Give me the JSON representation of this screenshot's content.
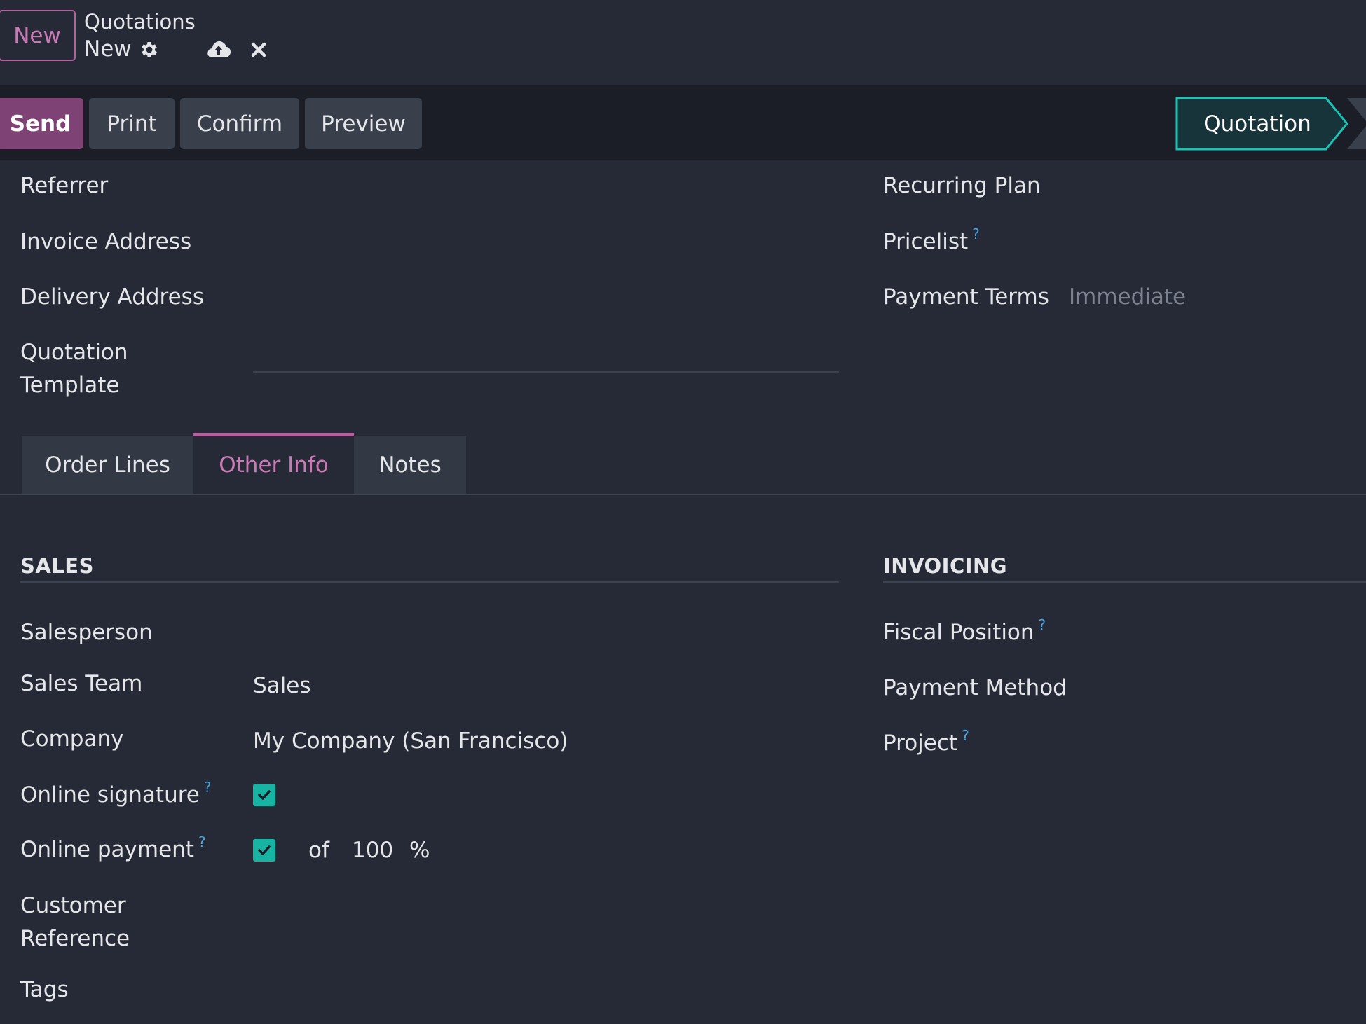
{
  "topbar": {
    "new_label": "New",
    "breadcrumb_parent": "Quotations",
    "breadcrumb_current": "New"
  },
  "actions": {
    "send": "Send",
    "print": "Print",
    "confirm": "Confirm",
    "preview": "Preview",
    "stage_current": "Quotation",
    "stage_accent": "#17c4b5"
  },
  "header_fields": {
    "referrer": "Referrer",
    "invoice_address": "Invoice Address",
    "delivery_address": "Delivery Address",
    "quotation_template_line1": "Quotation",
    "quotation_template_line2": "Template",
    "recurring_plan": "Recurring Plan",
    "pricelist": "Pricelist",
    "payment_terms": "Payment Terms",
    "payment_terms_placeholder": "Immediate",
    "help_mark": "?"
  },
  "tabs": [
    {
      "label": "Order Lines",
      "active": false
    },
    {
      "label": "Other Info",
      "active": true
    },
    {
      "label": "Notes",
      "active": false
    }
  ],
  "sales": {
    "title": "SALES",
    "salesperson": "Salesperson",
    "sales_team_label": "Sales Team",
    "sales_team_value": "Sales",
    "company_label": "Company",
    "company_value": "My Company (San Francisco)",
    "online_signature_label": "Online signature",
    "online_signature_checked": true,
    "online_payment_label": "Online payment",
    "online_payment_checked": true,
    "of_text": "of",
    "prepayment_percent": "100",
    "percent_sign": "%",
    "customer_reference_line1": "Customer",
    "customer_reference_line2": "Reference",
    "tags": "Tags"
  },
  "invoicing": {
    "title": "INVOICING",
    "fiscal_position": "Fiscal Position",
    "payment_method": "Payment Method",
    "project": "Project"
  }
}
